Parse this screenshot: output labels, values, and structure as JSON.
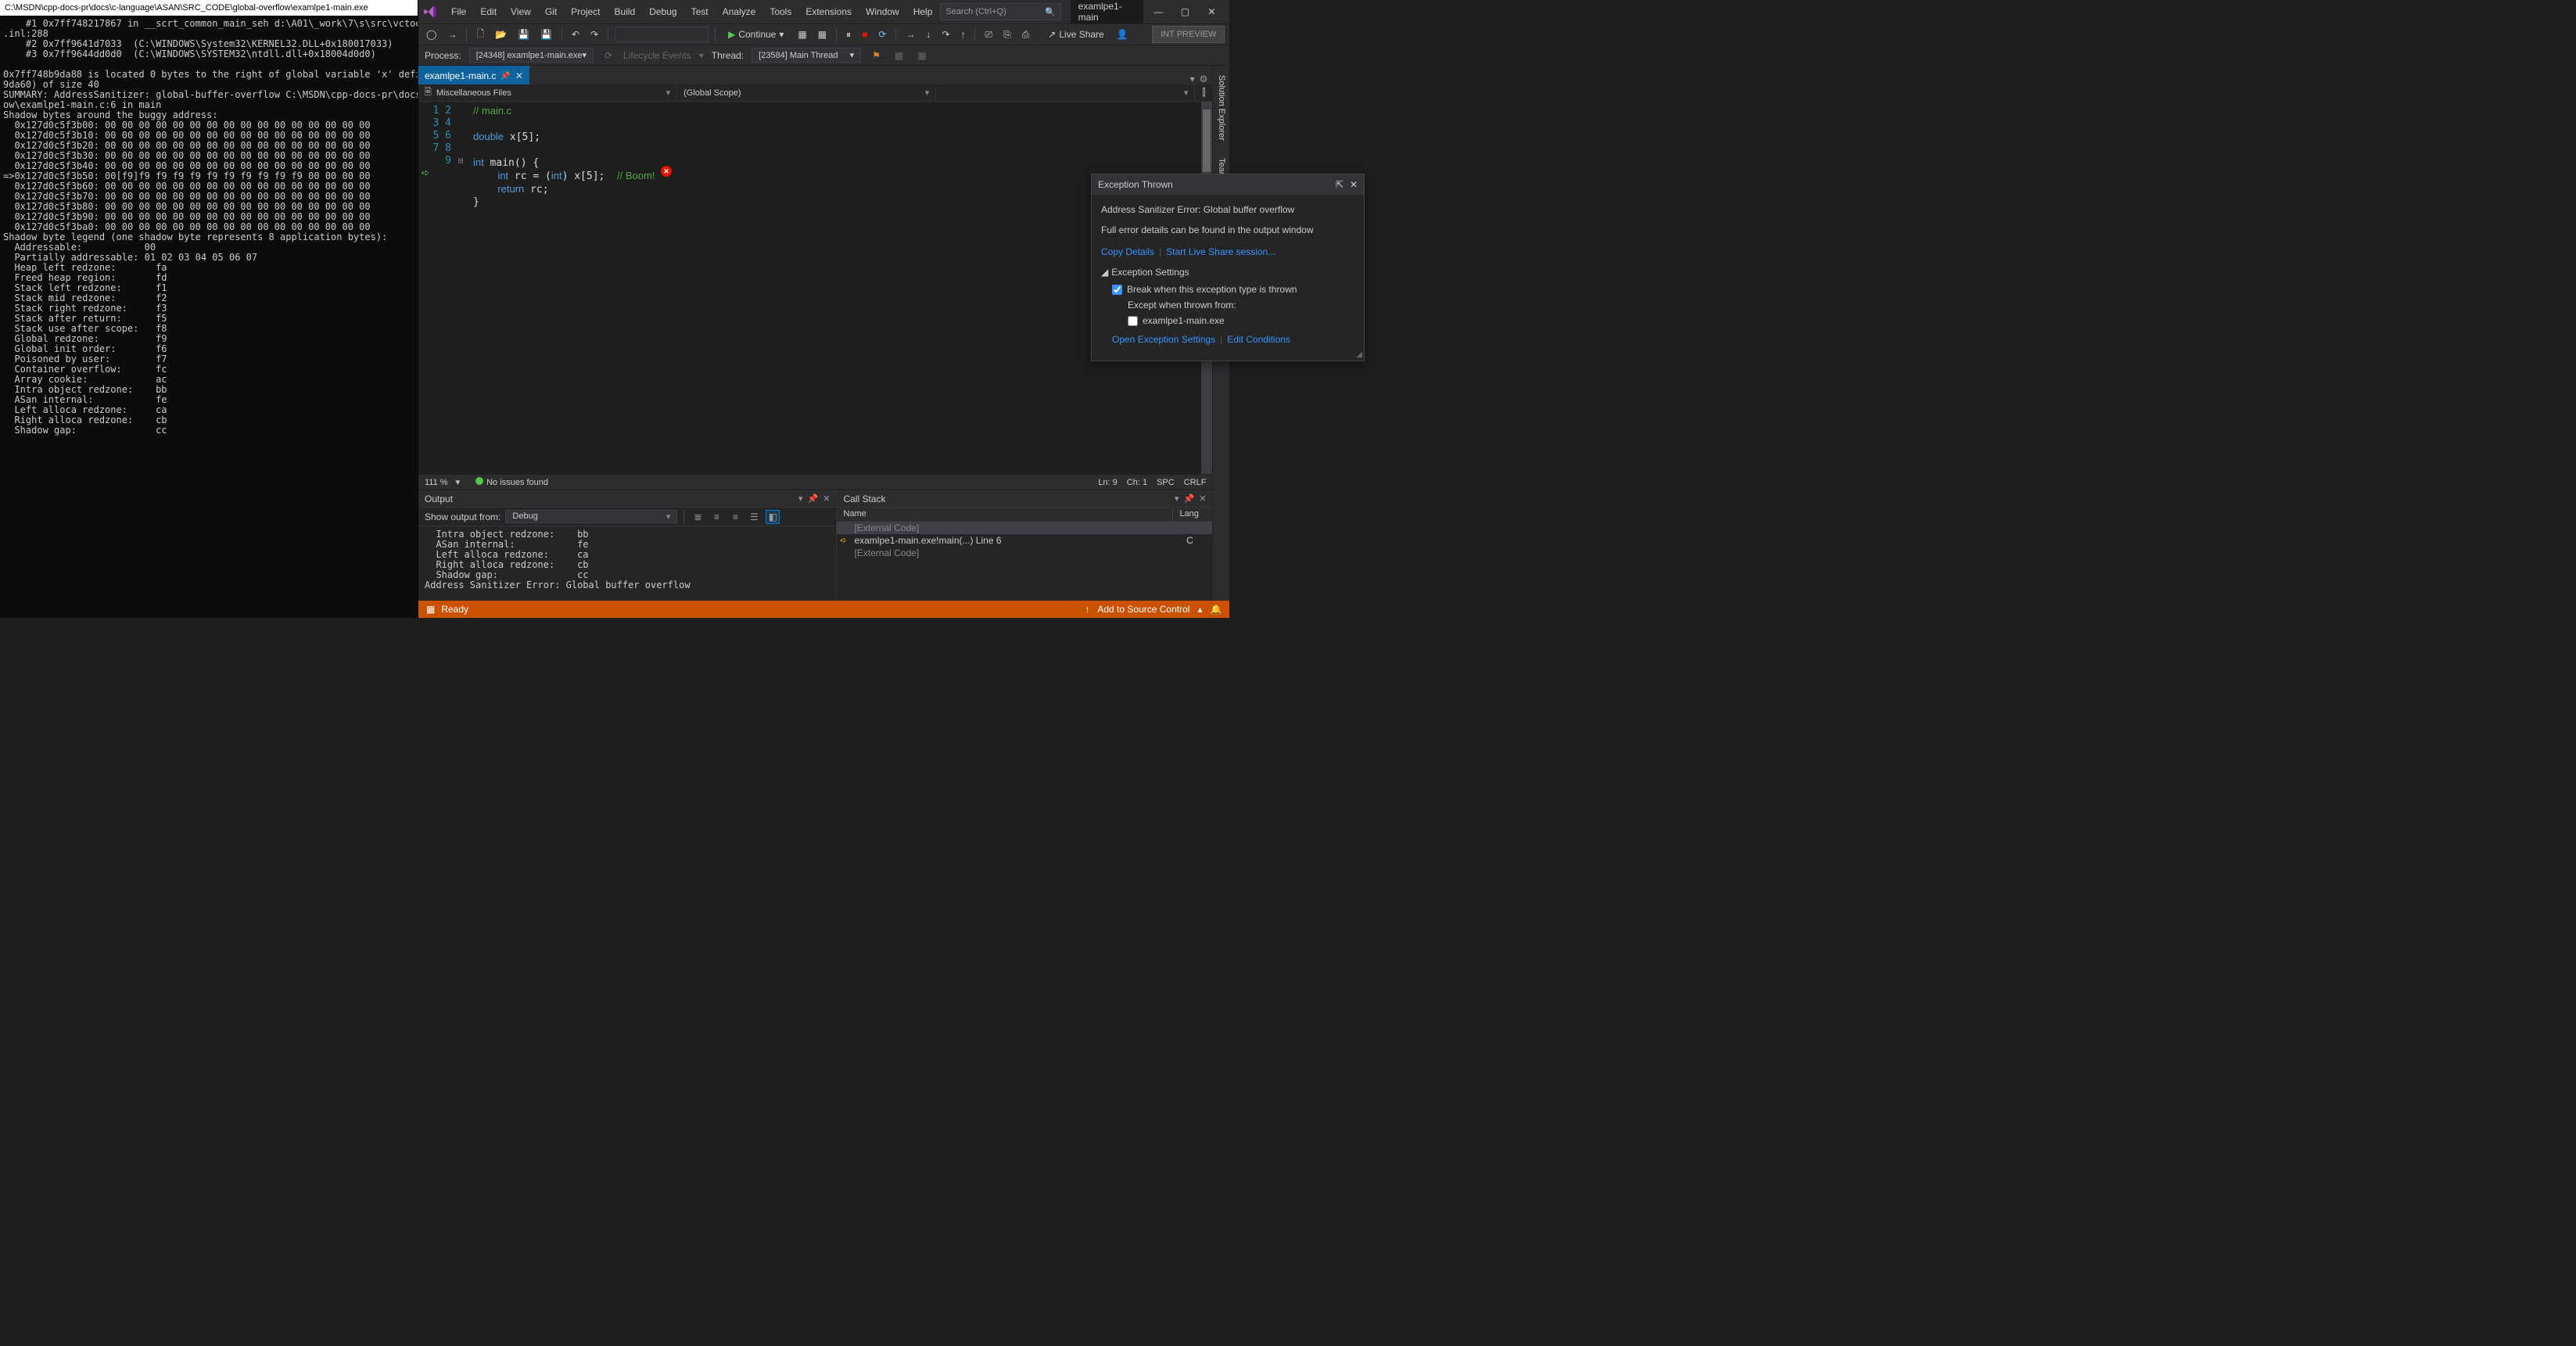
{
  "console": {
    "title": "C:\\MSDN\\cpp-docs-pr\\docs\\c-language\\ASAN\\SRC_CODE\\global-overflow\\examlpe1-main.exe",
    "body": "    #1 0x7ff748217867 in __scrt_common_main_seh d:\\A01\\_work\\7\\s\\src\\vctools\\crt\\vcstartu\n.inl:288\n    #2 0x7ff9641d7033  (C:\\WINDOWS\\System32\\KERNEL32.DLL+0x180017033)\n    #3 0x7ff9644dd0d0  (C:\\WINDOWS\\SYSTEM32\\ntdll.dll+0x18004d0d0)\n\n0x7ff748b9da88 is located 0 bytes to the right of global variable 'x' defined in 'examlpe\n9da60) of size 40\nSUMMARY: AddressSanitizer: global-buffer-overflow C:\\MSDN\\cpp-docs-pr\\docs\\c-language\\ASA\now\\examlpe1-main.c:6 in main\nShadow bytes around the buggy address:\n  0x127d0c5f3b00: 00 00 00 00 00 00 00 00 00 00 00 00 00 00 00 00\n  0x127d0c5f3b10: 00 00 00 00 00 00 00 00 00 00 00 00 00 00 00 00\n  0x127d0c5f3b20: 00 00 00 00 00 00 00 00 00 00 00 00 00 00 00 00\n  0x127d0c5f3b30: 00 00 00 00 00 00 00 00 00 00 00 00 00 00 00 00\n  0x127d0c5f3b40: 00 00 00 00 00 00 00 00 00 00 00 00 00 00 00 00\n=>0x127d0c5f3b50: 00[f9]f9 f9 f9 f9 f9 f9 f9 f9 f9 f9 00 00 00 00\n  0x127d0c5f3b60: 00 00 00 00 00 00 00 00 00 00 00 00 00 00 00 00\n  0x127d0c5f3b70: 00 00 00 00 00 00 00 00 00 00 00 00 00 00 00 00\n  0x127d0c5f3b80: 00 00 00 00 00 00 00 00 00 00 00 00 00 00 00 00\n  0x127d0c5f3b90: 00 00 00 00 00 00 00 00 00 00 00 00 00 00 00 00\n  0x127d0c5f3ba0: 00 00 00 00 00 00 00 00 00 00 00 00 00 00 00 00\nShadow byte legend (one shadow byte represents 8 application bytes):\n  Addressable:           00\n  Partially addressable: 01 02 03 04 05 06 07\n  Heap left redzone:       fa\n  Freed heap region:       fd\n  Stack left redzone:      f1\n  Stack mid redzone:       f2\n  Stack right redzone:     f3\n  Stack after return:      f5\n  Stack use after scope:   f8\n  Global redzone:          f9\n  Global init order:       f6\n  Poisoned by user:        f7\n  Container overflow:      fc\n  Array cookie:            ac\n  Intra object redzone:    bb\n  ASan internal:           fe\n  Left alloca redzone:     ca\n  Right alloca redzone:    cb\n  Shadow gap:              cc"
  },
  "menu": {
    "items": [
      "File",
      "Edit",
      "View",
      "Git",
      "Project",
      "Build",
      "Debug",
      "Test",
      "Analyze",
      "Tools",
      "Extensions",
      "Window",
      "Help"
    ]
  },
  "search": {
    "placeholder": "Search (Ctrl+Q)"
  },
  "solution_tab": "examlpe1-main",
  "toolbar": {
    "continue": "Continue",
    "liveshare": "Live Share",
    "intpreview": "INT PREVIEW"
  },
  "procbar": {
    "process_label": "Process:",
    "process_value": "[24348] examlpe1-main.exe",
    "lifecycle": "Lifecycle Events",
    "thread_label": "Thread:",
    "thread_value": "[23584] Main Thread"
  },
  "doctab": {
    "name": "examlpe1-main.c"
  },
  "nav": {
    "left": "Miscellaneous Files",
    "mid": "(Global Scope)",
    "right": ""
  },
  "code": {
    "lines": [
      "// main.c",
      "",
      "double x[5];",
      "",
      "int main() {",
      "    int rc = (int) x[5];  // Boom!",
      "    return rc;",
      "}",
      ""
    ]
  },
  "exception": {
    "title": "Exception Thrown",
    "error": "Address Sanitizer Error: Global buffer overflow",
    "detail": "Full error details can be found in the output window",
    "copy": "Copy Details",
    "liveshare": "Start Live Share session...",
    "settings_head": "Exception Settings",
    "break_when": "Break when this exception type is thrown",
    "except_when": "Except when thrown from:",
    "except_item": "examlpe1-main.exe",
    "open_settings": "Open Exception Settings",
    "edit_cond": "Edit Conditions"
  },
  "editor_status": {
    "zoom": "111 %",
    "issues": "No issues found",
    "ln": "Ln: 9",
    "ch": "Ch: 1",
    "spc": "SPC",
    "crlf": "CRLF"
  },
  "output": {
    "title": "Output",
    "show_from_label": "Show output from:",
    "show_from_value": "Debug",
    "body": "  Intra object redzone:    bb\n  ASan internal:           fe\n  Left alloca redzone:     ca\n  Right alloca redzone:    cb\n  Shadow gap:              cc\nAddress Sanitizer Error: Global buffer overflow\n"
  },
  "callstack": {
    "title": "Call Stack",
    "col_name": "Name",
    "col_lang": "Lang",
    "rows": [
      {
        "name": "[External Code]",
        "lang": "",
        "ext": true,
        "sel": true
      },
      {
        "name": "examlpe1-main.exe!main(...) Line 6",
        "lang": "C",
        "ext": false,
        "arrow": true
      },
      {
        "name": "[External Code]",
        "lang": "",
        "ext": true
      }
    ]
  },
  "sidetabs": {
    "t1": "Solution Explorer",
    "t2": "Team Explorer"
  },
  "status": {
    "ready": "Ready",
    "source": "Add to Source Control"
  }
}
